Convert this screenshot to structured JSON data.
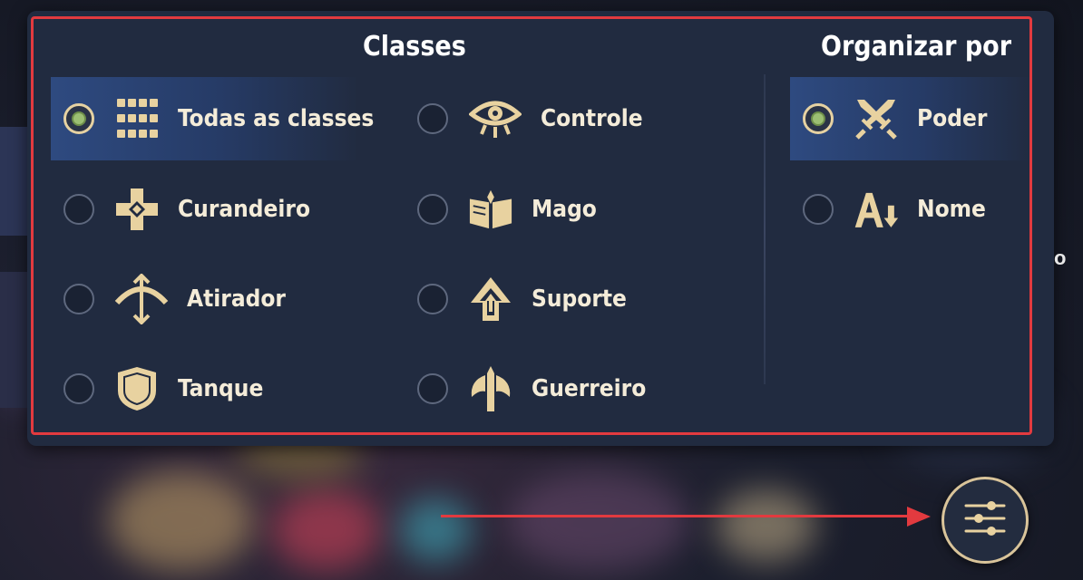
{
  "classes": {
    "heading": "Classes",
    "options": [
      {
        "label": "Todas as classes",
        "icon": "grid-icon",
        "selected": true
      },
      {
        "label": "Controle",
        "icon": "eye-icon",
        "selected": false
      },
      {
        "label": "Curandeiro",
        "icon": "healer-cross-icon",
        "selected": false
      },
      {
        "label": "Mago",
        "icon": "spellbook-icon",
        "selected": false
      },
      {
        "label": "Atirador",
        "icon": "bow-icon",
        "selected": false
      },
      {
        "label": "Suporte",
        "icon": "up-arrow-icon",
        "selected": false
      },
      {
        "label": "Tanque",
        "icon": "shield-icon",
        "selected": false
      },
      {
        "label": "Guerreiro",
        "icon": "axe-icon",
        "selected": false
      }
    ]
  },
  "sort": {
    "heading": "Organizar por",
    "options": [
      {
        "label": "Poder",
        "icon": "crossed-swords-icon",
        "selected": true
      },
      {
        "label": "Nome",
        "icon": "sort-alpha-down-icon",
        "selected": false
      }
    ]
  },
  "filter_button": {
    "icon": "sliders-icon"
  },
  "side_text": "o",
  "colors": {
    "panel": "#212b40",
    "highlight": "#e23a3f",
    "gold": "#e8d2a0",
    "selected_row": "#2e4a80",
    "radio_on": "#9cbf73"
  }
}
